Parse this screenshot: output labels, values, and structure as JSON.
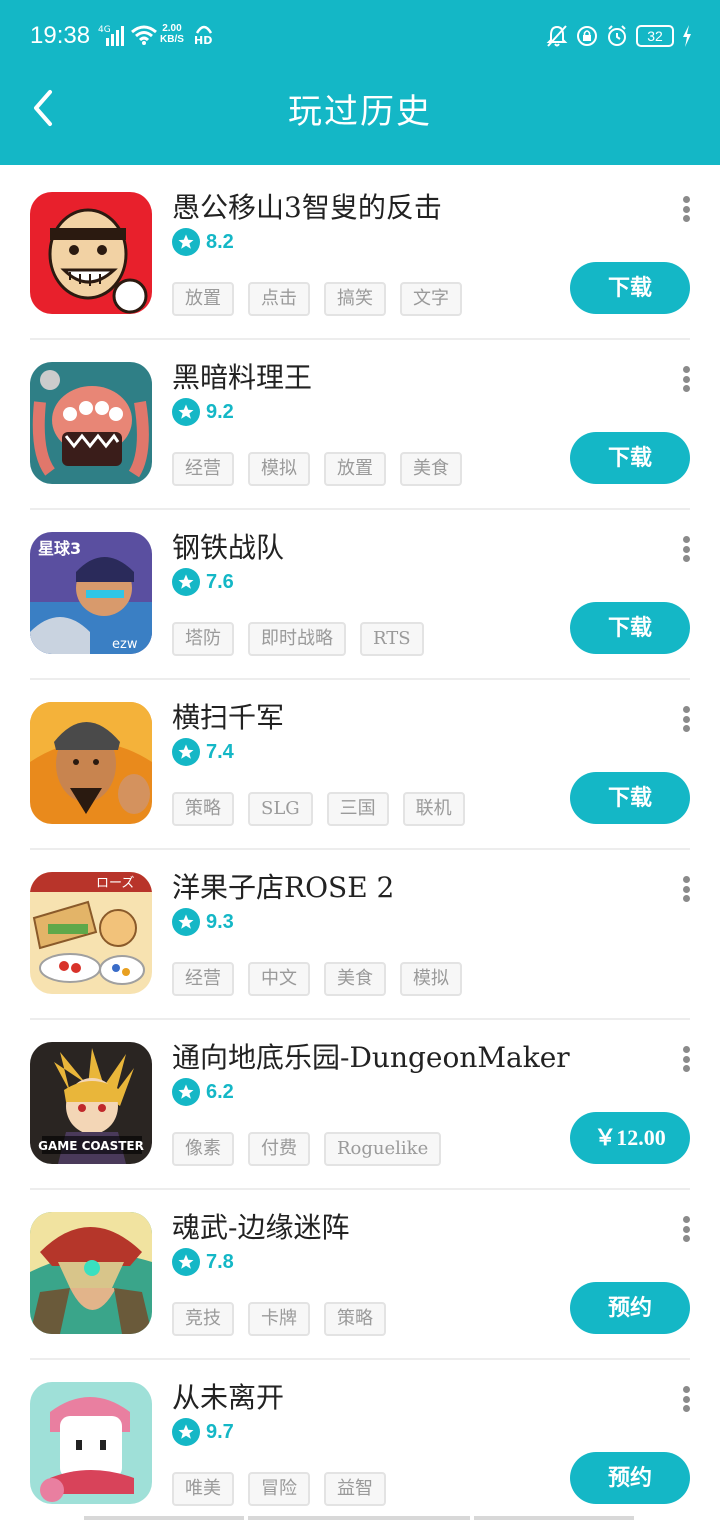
{
  "status_bar": {
    "time": "19:38",
    "network": "4G",
    "speed_value": "2.00",
    "speed_unit": "KB/S",
    "hd": "HD",
    "battery": "32",
    "icons": [
      "signal-icon",
      "wifi-icon",
      "hd-icon",
      "mute-bell-icon",
      "lock-icon",
      "alarm-icon",
      "battery-icon",
      "charging-icon"
    ]
  },
  "header": {
    "title": "玩过历史",
    "back_icon": "chevron-left-icon",
    "background": "#14b7c6"
  },
  "games": [
    {
      "name": "愚公移山3智叟的反击",
      "rating": "8.2",
      "tags": [
        "放置",
        "点击",
        "搞笑",
        "文字"
      ],
      "action": "下载"
    },
    {
      "name": "黑暗料理王",
      "rating": "9.2",
      "tags": [
        "经营",
        "模拟",
        "放置",
        "美食"
      ],
      "action": "下载"
    },
    {
      "name": "钢铁战队",
      "rating": "7.6",
      "tags": [
        "塔防",
        "即时战略",
        "RTS"
      ],
      "action": "下载"
    },
    {
      "name": "横扫千军",
      "rating": "7.4",
      "tags": [
        "策略",
        "SLG",
        "三国",
        "联机"
      ],
      "action": "下载"
    },
    {
      "name": "洋果子店ROSE 2",
      "rating": "9.3",
      "tags": [
        "经营",
        "中文",
        "美食",
        "模拟"
      ],
      "action": ""
    },
    {
      "name": "通向地底乐园-DungeonMaker",
      "rating": "6.2",
      "tags": [
        "像素",
        "付费",
        "Roguelike"
      ],
      "action": "￥12.00"
    },
    {
      "name": "魂武-边缘迷阵",
      "rating": "7.8",
      "tags": [
        "竞技",
        "卡牌",
        "策略"
      ],
      "action": "预约"
    },
    {
      "name": "从未离开",
      "rating": "9.7",
      "tags": [
        "唯美",
        "冒险",
        "益智"
      ],
      "action": "预约"
    }
  ],
  "icon_texts": {
    "game3": "星球3",
    "game3_corner": "ezw",
    "game5": "ローズ",
    "game6": "GAME COASTER"
  },
  "colors": {
    "accent": "#14b7c6",
    "tag_text": "#9a9a9a",
    "divider": "#ededed"
  }
}
